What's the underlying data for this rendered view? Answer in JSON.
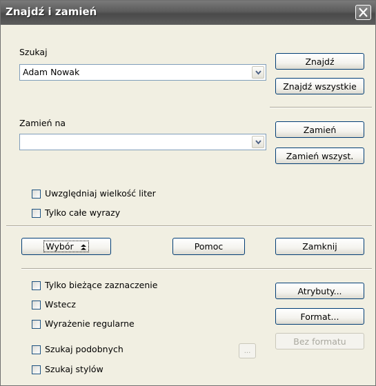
{
  "window": {
    "title": "Znajdź i zamień"
  },
  "search": {
    "label": "Szukaj",
    "value": "Adam Nowak"
  },
  "replace": {
    "label": "Zamień na",
    "value": ""
  },
  "buttons": {
    "find": "Znajdź",
    "find_all": "Znajdź wszystkie",
    "replace": "Zamień",
    "replace_all": "Zamień wszyst.",
    "selection": "Wybór",
    "help": "Pomoc",
    "close": "Zamknij",
    "attributes": "Atrybuty...",
    "format": "Format...",
    "no_format": "Bez formatu",
    "similarity_options": "..."
  },
  "options_basic": [
    {
      "label": "Uwzględniaj wielkość liter",
      "checked": false
    },
    {
      "label": "Tylko całe wyrazy",
      "checked": false
    }
  ],
  "options_more": [
    {
      "label": "Tylko bieżące zaznaczenie",
      "checked": false
    },
    {
      "label": "Wstecz",
      "checked": false
    },
    {
      "label": "Wyrażenie regularne",
      "checked": false
    },
    {
      "label": "Szukaj podobnych",
      "checked": false
    },
    {
      "label": "Szukaj stylów",
      "checked": false
    }
  ],
  "icons": {
    "close": "close-icon",
    "dropdown": "chevron-down-icon",
    "collapse": "double-chevron-up-icon"
  }
}
